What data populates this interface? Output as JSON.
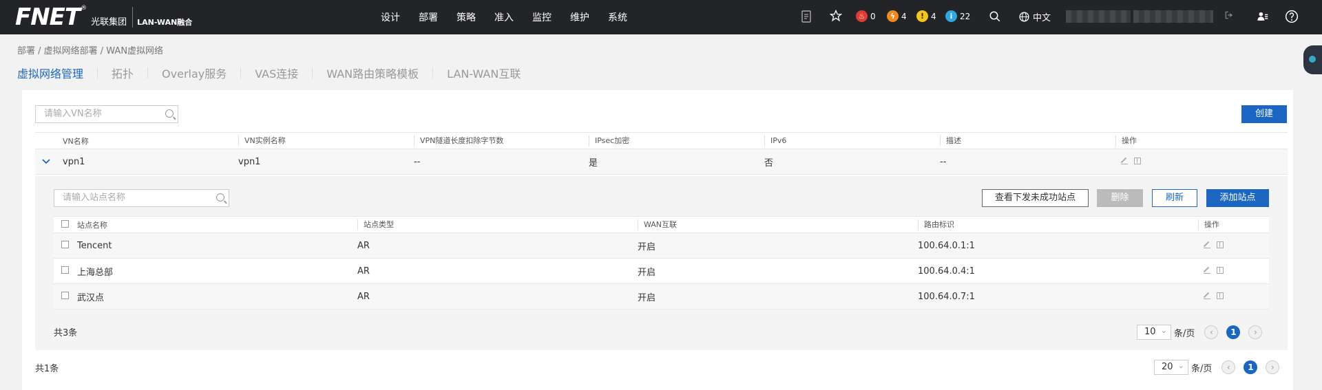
{
  "topbar": {
    "logo_mark": "FNET",
    "logo_reg": "®",
    "logo_group": "光联集团",
    "product": "LAN-WAN融合",
    "nav": [
      "设计",
      "部署",
      "策略",
      "准入",
      "监控",
      "维护",
      "系统"
    ],
    "alarms": {
      "critical": "0",
      "major": "4",
      "minor": "4",
      "info": "22"
    },
    "language": "中文"
  },
  "breadcrumb": "部署 / 虚拟网络部署 / WAN虚拟网络",
  "tabs": [
    "虚拟网络管理",
    "拓扑",
    "Overlay服务",
    "VAS连接",
    "WAN路由策略模板",
    "LAN-WAN互联"
  ],
  "vn": {
    "search_placeholder": "请输入VN名称",
    "create_label": "创建",
    "columns": [
      "VN名称",
      "VN实例名称",
      "VPN隧道长度扣除字节数",
      "IPsec加密",
      "IPv6",
      "描述",
      "操作"
    ],
    "rows": [
      {
        "name": "vpn1",
        "instance": "vpn1",
        "deduct": "--",
        "ipsec": "是",
        "ipv6": "否",
        "desc": "--"
      }
    ],
    "total": "共1条",
    "page_size": "20",
    "per_page": "条/页",
    "current_page": "1"
  },
  "sites": {
    "search_placeholder": "请输入站点名称",
    "btn_view_failed": "查看下发未成功站点",
    "btn_delete": "删除",
    "btn_refresh": "刷新",
    "btn_add": "添加站点",
    "columns": [
      "站点名称",
      "站点类型",
      "WAN互联",
      "路由标识",
      "操作"
    ],
    "rows": [
      {
        "name": "Tencent",
        "type": "AR",
        "wan": "开启",
        "rd": "100.64.0.1:1"
      },
      {
        "name": "上海总部",
        "type": "AR",
        "wan": "开启",
        "rd": "100.64.0.4:1"
      },
      {
        "name": "武汉点",
        "type": "AR",
        "wan": "开启",
        "rd": "100.64.0.7:1"
      }
    ],
    "total": "共3条",
    "page_size": "10",
    "per_page": "条/页",
    "current_page": "1"
  },
  "colors": {
    "accent": "#1a66c2",
    "topbar": "#222428"
  }
}
